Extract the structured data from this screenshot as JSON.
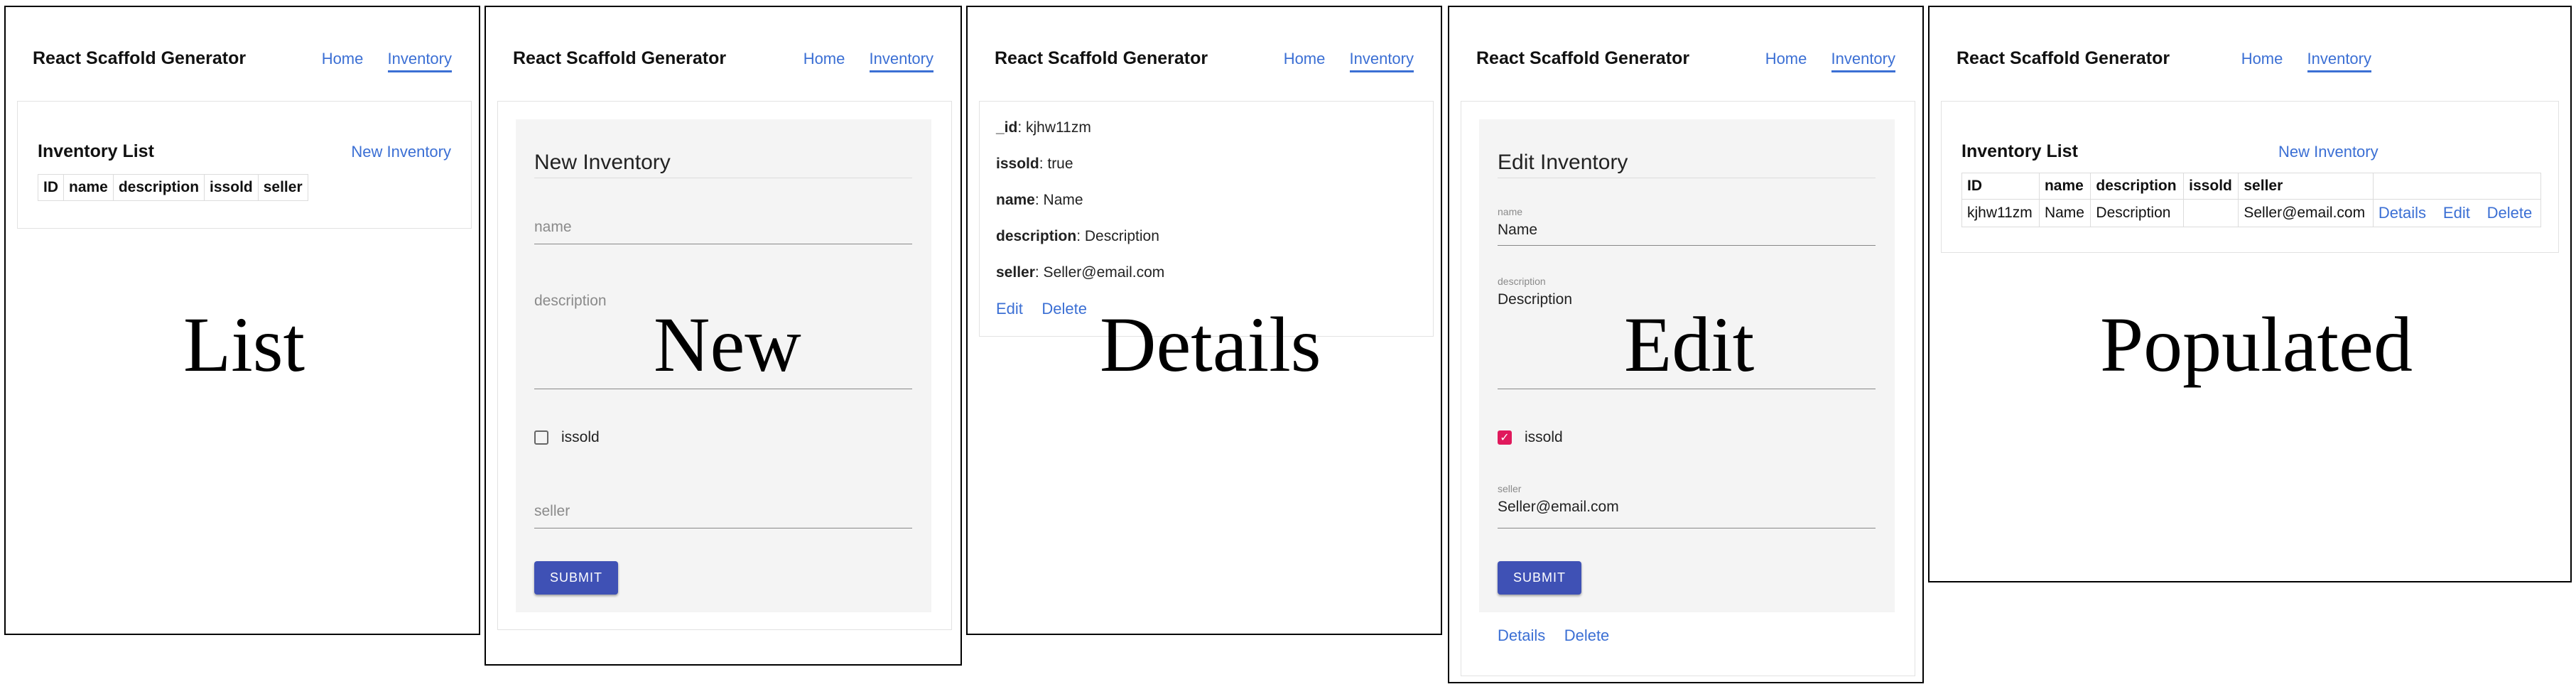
{
  "app": {
    "title": "React Scaffold Generator",
    "nav_home": "Home",
    "nav_inventory": "Inventory"
  },
  "list": {
    "heading": "Inventory List",
    "new_link": "New Inventory",
    "columns": [
      "ID",
      "name",
      "description",
      "issold",
      "seller"
    ],
    "caption": "List"
  },
  "new_form": {
    "heading": "New Inventory",
    "name_placeholder": "name",
    "description_placeholder": "description",
    "issold_label": "issold",
    "seller_placeholder": "seller",
    "submit": "SUBMIT",
    "caption": "New"
  },
  "details": {
    "fields": [
      {
        "key": "_id",
        "value": ": kjhw11zm"
      },
      {
        "key": "issold",
        "value": ": true"
      },
      {
        "key": "name",
        "value": ": Name"
      },
      {
        "key": "description",
        "value": ": Description"
      },
      {
        "key": "seller",
        "value": ": Seller@email.com"
      }
    ],
    "edit_link": "Edit",
    "delete_link": "Delete",
    "caption": "Details"
  },
  "edit_form": {
    "heading": "Edit Inventory",
    "name_label": "name",
    "name_value": "Name",
    "description_label": "description",
    "description_value": "Description",
    "issold_label": "issold",
    "issold_checked": true,
    "seller_label": "seller",
    "seller_value": "Seller@email.com",
    "submit": "SUBMIT",
    "details_link": "Details",
    "delete_link": "Delete",
    "caption": "Edit"
  },
  "populated": {
    "heading": "Inventory List",
    "new_link": "New Inventory",
    "columns": [
      "ID",
      "name",
      "description",
      "issold",
      "seller"
    ],
    "rows": [
      {
        "id": "kjhw11zm",
        "name": "Name",
        "description": "Description",
        "issold": "",
        "seller": "Seller@email.com"
      }
    ],
    "row_actions": {
      "details": "Details",
      "edit": "Edit",
      "delete": "Delete"
    },
    "caption": "Populated"
  },
  "colors": {
    "link": "#3b6fd4",
    "submit": "#3f51b5",
    "checkbox_checked": "#e0195c",
    "form_bg": "#f4f4f4"
  },
  "icons": {
    "checked": "check-icon"
  }
}
